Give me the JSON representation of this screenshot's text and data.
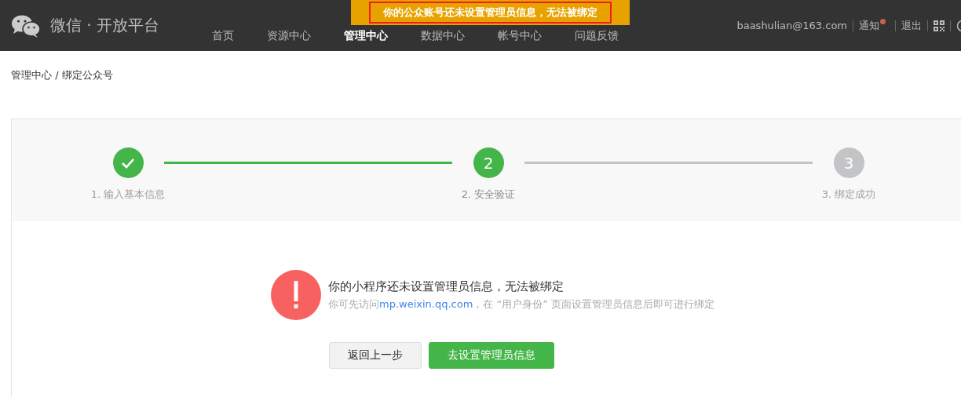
{
  "header": {
    "logo_text": "微信 · 开放平台",
    "nav": [
      {
        "label": "首页",
        "selected": false
      },
      {
        "label": "资源中心",
        "selected": false
      },
      {
        "label": "管理中心",
        "selected": true
      },
      {
        "label": "数据中心",
        "selected": false
      },
      {
        "label": "帐号中心",
        "selected": false
      },
      {
        "label": "问题反馈",
        "selected": false
      }
    ],
    "account": "baashulian@163.com",
    "notice": {
      "label": "通知",
      "unread": true
    },
    "logout": "退出"
  },
  "banner": {
    "text": "你的公众账号还未设置管理员信息，无法被绑定"
  },
  "breadcrumb": "管理中心 / 绑定公众号",
  "steps": [
    {
      "label": "1. 输入基本信息",
      "completed": true,
      "selected": false
    },
    {
      "label": "2. 安全验证",
      "number": "2",
      "completed": false,
      "selected": true
    },
    {
      "label": "3. 绑定成功",
      "number": "3",
      "completed": false,
      "selected": false
    }
  ],
  "alert": {
    "title": "你的小程序还未设置管理员信息，无法被绑定",
    "hint_prefix": "你可先访问",
    "hint_link": "mp.weixin.qq.com",
    "hint_suffix": "，在 “用户身份” 页面设置管理员信息后即可进行绑定"
  },
  "buttons": [
    {
      "label": "返回上一步",
      "kind": "secondary"
    },
    {
      "label": "去设置管理员信息",
      "kind": "primary"
    }
  ]
}
